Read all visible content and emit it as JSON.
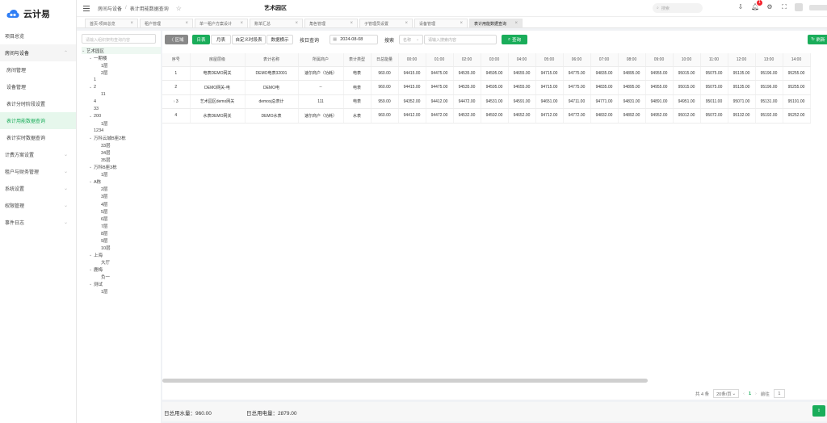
{
  "app": {
    "name": "云计易",
    "project": "艺术园区"
  },
  "breadcrumb": [
    "房间与设备",
    "表计用能数据查询"
  ],
  "header": {
    "search_placeholder": "搜索",
    "notification_count": "1"
  },
  "sidebar": {
    "items": [
      {
        "label": "项目总览",
        "has_children": false
      },
      {
        "label": "房间与设备",
        "has_children": true,
        "open": true
      },
      {
        "label": "房间管理",
        "sub": true
      },
      {
        "label": "设备管理",
        "sub": true
      },
      {
        "label": "表计分时阶段设置",
        "sub": true
      },
      {
        "label": "表计用能数据查询",
        "sub": true,
        "active": true
      },
      {
        "label": "表计实时数据查询",
        "sub": true
      },
      {
        "label": "计费方案设置",
        "has_children": true
      },
      {
        "label": "租户与财务管理",
        "has_children": true
      },
      {
        "label": "系统设置",
        "has_children": true
      },
      {
        "label": "权限管理",
        "has_children": true
      },
      {
        "label": "事件日志",
        "has_children": true
      }
    ]
  },
  "tabs": [
    {
      "label": "首页-项目总览"
    },
    {
      "label": "租户管理"
    },
    {
      "label": "单一租户方案设计"
    },
    {
      "label": "账单汇总"
    },
    {
      "label": "角色管理"
    },
    {
      "label": "子管理员设置"
    },
    {
      "label": "设备管理"
    },
    {
      "label": "表计用能数据查询",
      "active": true
    }
  ],
  "tree": {
    "search_placeholder": "请输入组织架构查询内容",
    "nodes": [
      {
        "label": "艺术园区",
        "level": 0,
        "caret": "⌄",
        "selected": true
      },
      {
        "label": "一期楼",
        "level": 1,
        "caret": "⌄"
      },
      {
        "label": "1层",
        "level": 2
      },
      {
        "label": "2层",
        "level": 2
      },
      {
        "label": "1",
        "level": 1
      },
      {
        "label": "2",
        "level": 1,
        "caret": "⌄"
      },
      {
        "label": "11",
        "level": 2
      },
      {
        "label": "4",
        "level": 1
      },
      {
        "label": "33",
        "level": 1
      },
      {
        "label": "200",
        "level": 1,
        "caret": "⌄"
      },
      {
        "label": "1层",
        "level": 2
      },
      {
        "label": "1234",
        "level": 1
      },
      {
        "label": "万科云城B座2栋",
        "level": 1,
        "caret": "⌄"
      },
      {
        "label": "33层",
        "level": 2
      },
      {
        "label": "34层",
        "level": 2
      },
      {
        "label": "35层",
        "level": 2
      },
      {
        "label": "万科B座3栋",
        "level": 1,
        "caret": "⌄"
      },
      {
        "label": "1层",
        "level": 2
      },
      {
        "label": "A栋",
        "level": 1,
        "caret": "⌄"
      },
      {
        "label": "2层",
        "level": 2
      },
      {
        "label": "3层",
        "level": 2
      },
      {
        "label": "4层",
        "level": 2
      },
      {
        "label": "5层",
        "level": 2
      },
      {
        "label": "6层",
        "level": 2
      },
      {
        "label": "7层",
        "level": 2
      },
      {
        "label": "8层",
        "level": 2
      },
      {
        "label": "9层",
        "level": 2
      },
      {
        "label": "10层",
        "level": 2
      },
      {
        "label": "上海",
        "level": 1,
        "caret": "⌄"
      },
      {
        "label": "大厅",
        "level": 2
      },
      {
        "label": "鹿梅",
        "level": 1,
        "caret": "⌄"
      },
      {
        "label": "负一",
        "level": 2
      },
      {
        "label": "测试",
        "level": 1,
        "caret": "⌄"
      },
      {
        "label": "1层",
        "level": 2
      }
    ]
  },
  "toolbar": {
    "collapse_label": "〈 区域",
    "mode_buttons": [
      "日表",
      "月表",
      "自定义时段表",
      "数据横示"
    ],
    "date_label": "按日查询",
    "date_value": "2024-08-08",
    "search_label": "搜索",
    "select_value": "名称",
    "search_placeholder": "请输入搜索内容",
    "query_button": "查询",
    "refresh_button": "刷新"
  },
  "table": {
    "headers": [
      "序号",
      "房屋层级",
      "表计名称",
      "所属商户",
      "表计类型",
      "日总能量",
      "00:00",
      "01:00",
      "02:00",
      "03:00",
      "04:00",
      "05:00",
      "06:00",
      "07:00",
      "08:00",
      "09:00",
      "10:00",
      "11:00",
      "12:00",
      "13:00",
      "14:00"
    ],
    "rows": [
      [
        "1",
        "电表DEMO网关",
        "DEMO电表32001",
        "速尔商户（功耗）",
        "电表",
        "960.00",
        "94415.00",
        "94475.00",
        "94535.00",
        "94595.00",
        "94655.00",
        "94715.00",
        "94775.00",
        "94835.00",
        "94895.00",
        "94955.00",
        "95015.00",
        "95075.00",
        "95135.00",
        "95196.00",
        "95255.00"
      ],
      [
        "2",
        "DEMO网关-电",
        "DEMO电",
        "--",
        "电表",
        "960.00",
        "94415.00",
        "94475.00",
        "94535.00",
        "94595.00",
        "94655.00",
        "94715.00",
        "94775.00",
        "94835.00",
        "94895.00",
        "94955.00",
        "95015.00",
        "95075.00",
        "95135.00",
        "95196.00",
        "95255.00"
      ],
      [
        "3",
        "艺术园区demo网关",
        "demoxj总表计",
        "111",
        "电表",
        "959.00",
        "94352.00",
        "94412.00",
        "94472.00",
        "94531.00",
        "94591.00",
        "94651.00",
        "94711.00",
        "94771.00",
        "94831.00",
        "94891.00",
        "94951.00",
        "95011.00",
        "95071.00",
        "95131.00",
        "95191.00"
      ],
      [
        "4",
        "水表DEMO网关",
        "DEMO水表",
        "速尔商户（功耗）",
        "水表",
        "960.00",
        "94412.00",
        "94472.00",
        "94532.00",
        "94592.00",
        "94652.00",
        "94712.00",
        "94772.00",
        "94832.00",
        "94892.00",
        "94952.00",
        "95012.00",
        "95072.00",
        "95132.00",
        "95192.00",
        "95252.00"
      ]
    ]
  },
  "pager": {
    "total": "共 4 条",
    "page_size": "20条/页",
    "current": "1",
    "goto_label": "前往",
    "goto_value": "1"
  },
  "footer": {
    "water": "日总用水量：960.00",
    "electric": "日总用电量：2879.00",
    "export": "导出"
  },
  "colors": {
    "accent": "#1aad5a"
  }
}
